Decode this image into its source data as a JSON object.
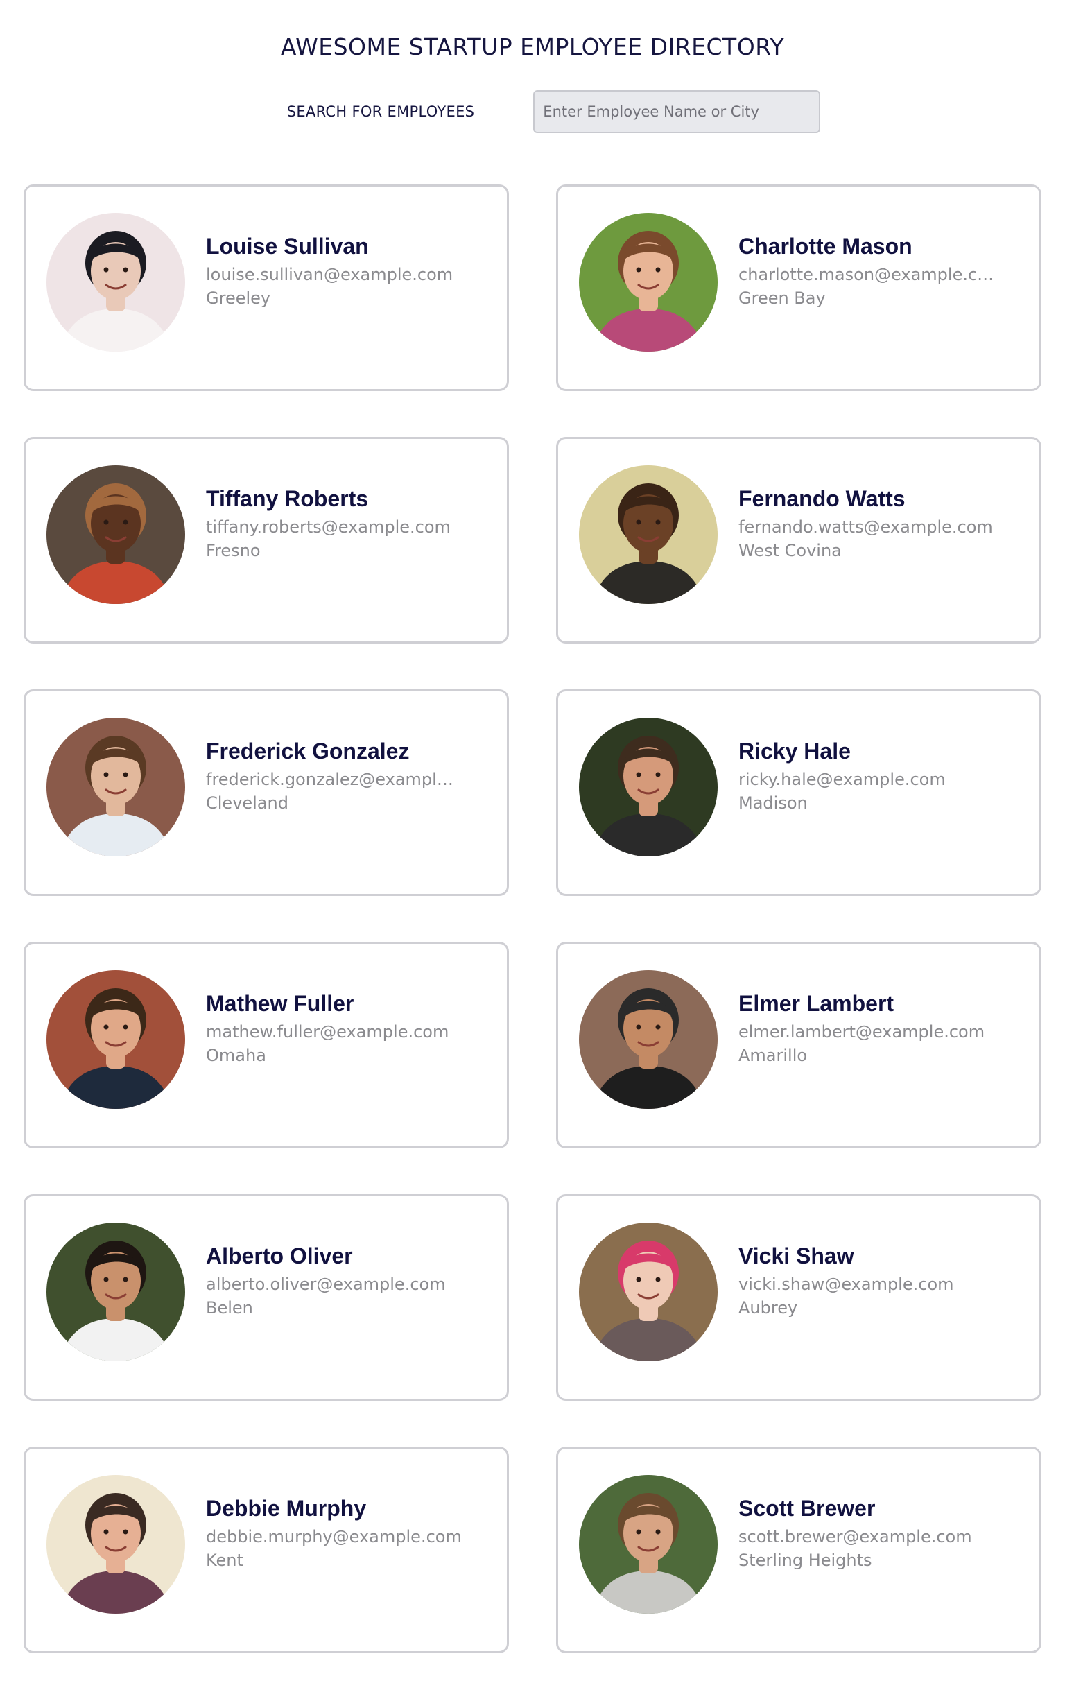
{
  "header": {
    "title": "AWESOME STARTUP EMPLOYEE DIRECTORY"
  },
  "search": {
    "label": "SEARCH FOR EMPLOYEES",
    "placeholder": "Enter Employee Name or City",
    "value": ""
  },
  "employees": [
    {
      "name": "Louise Sullivan",
      "email": "louise.sullivan@example.com",
      "city": "Greeley",
      "photo": {
        "bg": "#efe4e6",
        "skin": "#e9c9b8",
        "hair": "#1b1b22",
        "shirt": "#f6f2f2"
      }
    },
    {
      "name": "Charlotte Mason",
      "email": "charlotte.mason@example.com",
      "city": "Green Bay",
      "photo": {
        "bg": "#6e9a3e",
        "skin": "#e8b596",
        "hair": "#7a4a2c",
        "shirt": "#b84a78"
      }
    },
    {
      "name": "Tiffany Roberts",
      "email": "tiffany.roberts@example.com",
      "city": "Fresno",
      "photo": {
        "bg": "#5a4a3e",
        "skin": "#5b3420",
        "hair": "#a2693e",
        "shirt": "#c84830"
      }
    },
    {
      "name": "Fernando Watts",
      "email": "fernando.watts@example.com",
      "city": "West Covina",
      "photo": {
        "bg": "#d9cf9a",
        "skin": "#6b4126",
        "hair": "#3a2416",
        "shirt": "#2c2a26"
      }
    },
    {
      "name": "Frederick Gonzalez",
      "email": "frederick.gonzalez@example.com",
      "city": "Cleveland",
      "photo": {
        "bg": "#8a5a4a",
        "skin": "#e2b89c",
        "hair": "#5a3a24",
        "shirt": "#e6ecf2"
      }
    },
    {
      "name": "Ricky Hale",
      "email": "ricky.hale@example.com",
      "city": "Madison",
      "photo": {
        "bg": "#2e3a22",
        "skin": "#d59a7a",
        "hair": "#3e2c1e",
        "shirt": "#2a2a2a"
      }
    },
    {
      "name": "Mathew Fuller",
      "email": "mathew.fuller@example.com",
      "city": "Omaha",
      "photo": {
        "bg": "#a2503a",
        "skin": "#e0a888",
        "hair": "#3c2818",
        "shirt": "#1e2a3c"
      }
    },
    {
      "name": "Elmer Lambert",
      "email": "elmer.lambert@example.com",
      "city": "Amarillo",
      "photo": {
        "bg": "#8c6a58",
        "skin": "#c48a64",
        "hair": "#2a2a2a",
        "shirt": "#1e1e1e"
      }
    },
    {
      "name": "Alberto Oliver",
      "email": "alberto.oliver@example.com",
      "city": "Belen",
      "photo": {
        "bg": "#40502e",
        "skin": "#c9916c",
        "hair": "#1e1612",
        "shirt": "#f2f2f2"
      }
    },
    {
      "name": "Vicki Shaw",
      "email": "vicki.shaw@example.com",
      "city": "Aubrey",
      "photo": {
        "bg": "#8a6e4e",
        "skin": "#efcab6",
        "hair": "#d83a6a",
        "shirt": "#6a5a5a"
      }
    },
    {
      "name": "Debbie Murphy",
      "email": "debbie.murphy@example.com",
      "city": "Kent",
      "photo": {
        "bg": "#efe6d0",
        "skin": "#e6b094",
        "hair": "#3a2a22",
        "shirt": "#6a3e50"
      }
    },
    {
      "name": "Scott Brewer",
      "email": "scott.brewer@example.com",
      "city": "Sterling Heights",
      "photo": {
        "bg": "#4e6a3a",
        "skin": "#d8a484",
        "hair": "#6a4a2e",
        "shirt": "#c8c8c4"
      }
    }
  ]
}
